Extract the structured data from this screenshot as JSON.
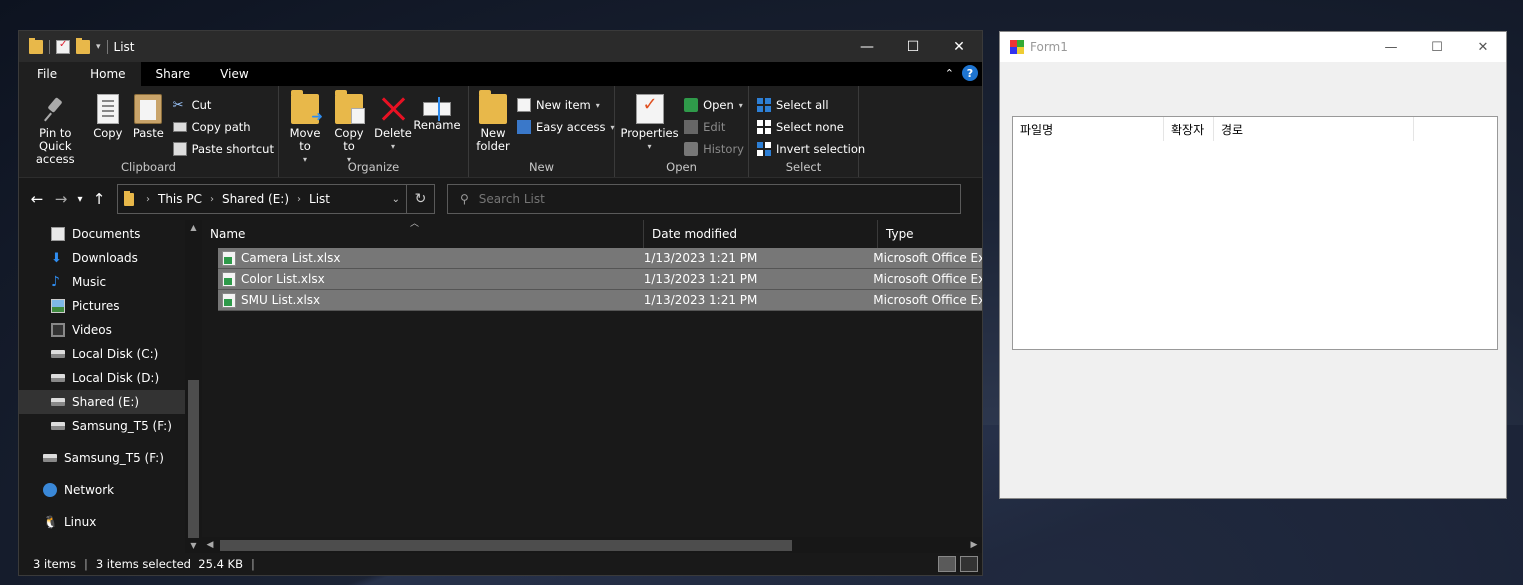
{
  "explorer": {
    "title": "List",
    "tabs": [
      "File",
      "Home",
      "Share",
      "View"
    ],
    "help": "?",
    "ribbon": {
      "clipboard": {
        "label": "Clipboard",
        "pin": "Pin to Quick access",
        "copy": "Copy",
        "paste": "Paste",
        "cut": "Cut",
        "copy_path": "Copy path",
        "paste_shortcut": "Paste shortcut"
      },
      "organize": {
        "label": "Organize",
        "move_to": "Move to",
        "copy_to": "Copy to",
        "delete": "Delete",
        "rename": "Rename"
      },
      "new": {
        "label": "New",
        "new_folder": "New folder",
        "new_item": "New item",
        "easy_access": "Easy access"
      },
      "open": {
        "label": "Open",
        "properties": "Properties",
        "open": "Open",
        "edit": "Edit",
        "history": "History"
      },
      "select": {
        "label": "Select",
        "select_all": "Select all",
        "select_none": "Select none",
        "invert_selection": "Invert selection"
      }
    },
    "address": {
      "crumbs": [
        "This PC",
        "Shared (E:)",
        "List"
      ]
    },
    "search": {
      "placeholder": "Search List"
    },
    "nav": [
      {
        "label": "Documents",
        "icon": "documents-icon"
      },
      {
        "label": "Downloads",
        "icon": "downloads-icon"
      },
      {
        "label": "Music",
        "icon": "music-icon"
      },
      {
        "label": "Pictures",
        "icon": "pictures-icon"
      },
      {
        "label": "Videos",
        "icon": "videos-icon"
      },
      {
        "label": "Local Disk (C:)",
        "icon": "drive-icon"
      },
      {
        "label": "Local Disk (D:)",
        "icon": "drive-icon"
      },
      {
        "label": "Shared (E:)",
        "icon": "drive-icon",
        "selected": true
      },
      {
        "label": "Samsung_T5 (F:)",
        "icon": "drive-icon"
      },
      {
        "label": "Samsung_T5 (F:)",
        "icon": "drive-icon"
      },
      {
        "label": "Network",
        "icon": "network-icon"
      },
      {
        "label": "Linux",
        "icon": "linux-icon"
      }
    ],
    "columns": [
      "Name",
      "Date modified",
      "Type"
    ],
    "files": [
      {
        "name": "Camera List.xlsx",
        "date": "1/13/2023 1:21 PM",
        "type": "Microsoft Office Ex"
      },
      {
        "name": "Color List.xlsx",
        "date": "1/13/2023 1:21 PM",
        "type": "Microsoft Office Ex"
      },
      {
        "name": "SMU List.xlsx",
        "date": "1/13/2023 1:21 PM",
        "type": "Microsoft Office Ex"
      }
    ],
    "status": {
      "items": "3 items",
      "selected": "3 items selected  25.4 KB"
    }
  },
  "form1": {
    "title": "Form1",
    "columns": [
      "파일명",
      "확장자",
      "경로"
    ]
  },
  "colors": {
    "accent": "#1e74d0",
    "selected_row": "#777777",
    "delete_red": "#e81123"
  }
}
